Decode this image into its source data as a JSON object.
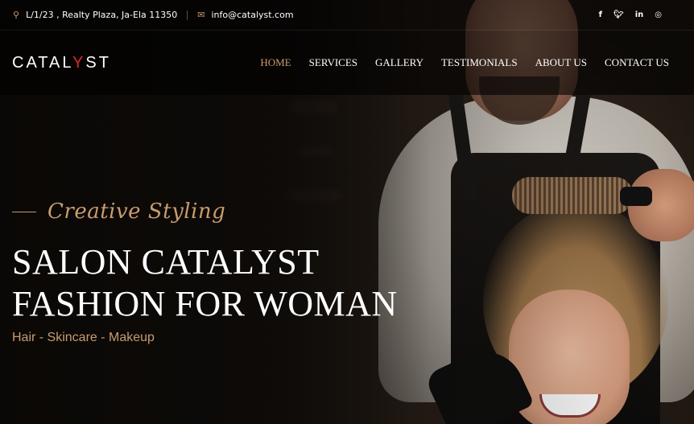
{
  "topbar": {
    "address": "L/1/23 , Realty Plaza, Ja-Ela 11350",
    "email": "info@catalyst.com",
    "socials": [
      "f",
      "t",
      "in",
      "ig"
    ]
  },
  "brand": {
    "logo_part1": "CATAL",
    "logo_y": "Y",
    "logo_part2": "ST",
    "accent": "#c99b6d",
    "logo_red": "#e0262b"
  },
  "nav": {
    "items": [
      "HOME",
      "SERVICES",
      "GALLERY",
      "TESTIMONIALS",
      "ABOUT US",
      "CONTACT US"
    ],
    "active": "HOME"
  },
  "hero": {
    "kicker": "Creative Styling",
    "title_line1": "SALON CATALYST",
    "title_line2": "FASHION FOR WOMAN",
    "subtitle": "Hair - Skincare - Makeup"
  }
}
